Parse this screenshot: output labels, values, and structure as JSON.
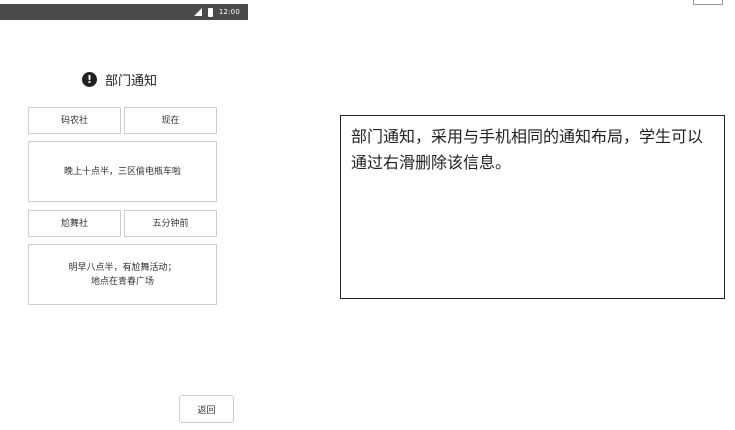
{
  "status_bar": {
    "time": "12:00",
    "icons": [
      "signal-icon",
      "battery-icon"
    ]
  },
  "header": {
    "icon": "alert-icon",
    "icon_glyph": "!",
    "title": "部门通知"
  },
  "notifications": [
    {
      "sender": "码农社",
      "time": "现在",
      "message_lines": [
        "晚上十点半，三区偷电瓶车啦"
      ]
    },
    {
      "sender": "尬舞社",
      "time": "五分钟前",
      "message_lines": [
        "明早八点半，有尬舞活动；",
        "地点在青春广场"
      ]
    }
  ],
  "back_button": {
    "label": "返回"
  },
  "annotation": {
    "text": "部门通知，采用与手机相同的通知布局，学生可以通过右滑删除该信息。"
  }
}
